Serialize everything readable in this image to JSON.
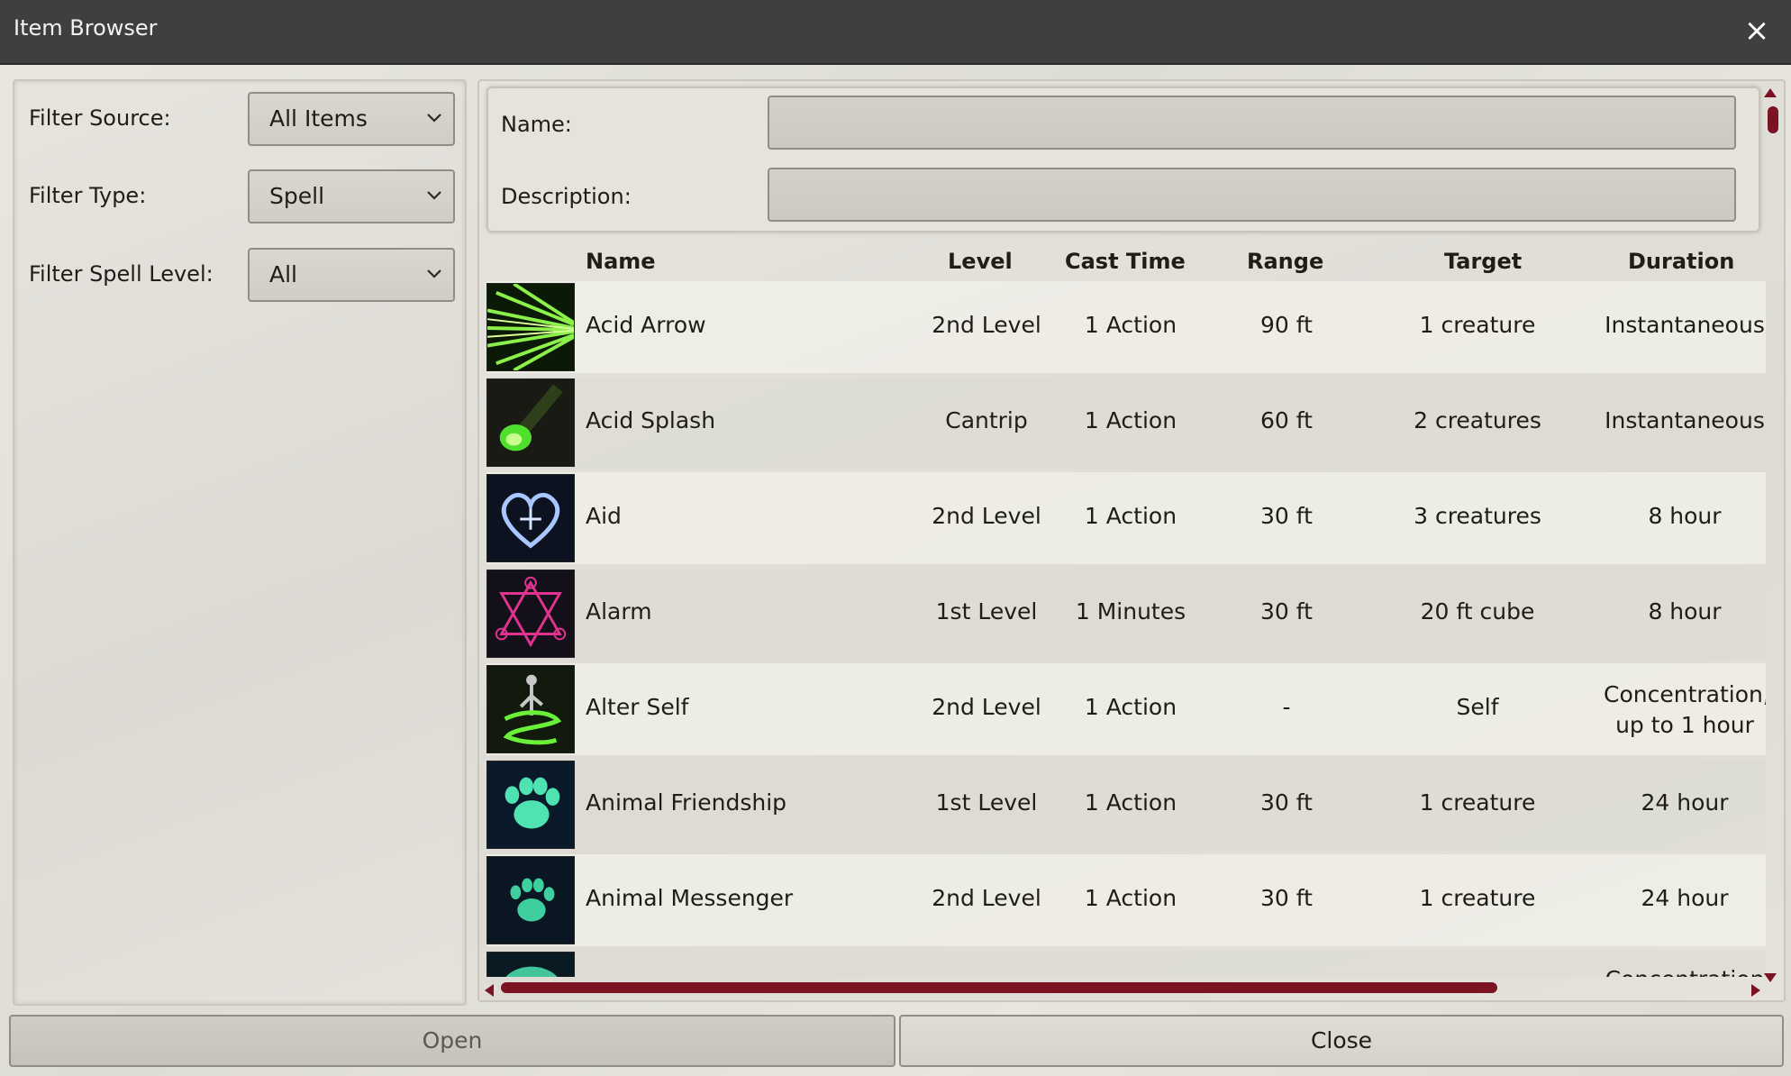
{
  "window": {
    "title": "Item Browser",
    "close_icon": "×"
  },
  "filters": [
    {
      "label": "Filter Source:",
      "value": "All Items"
    },
    {
      "label": "Filter Type:",
      "value": "Spell"
    },
    {
      "label": "Filter Spell Level:",
      "value": "All"
    }
  ],
  "search": {
    "name_label": "Name:",
    "name_value": "",
    "description_label": "Description:",
    "description_value": ""
  },
  "table": {
    "columns": [
      "Name",
      "Level",
      "Cast Time",
      "Range",
      "Target",
      "Duration"
    ],
    "rows": [
      {
        "icon": "acid-arrow-icon",
        "name": "Acid Arrow",
        "level": "2nd Level",
        "cast_time": "1 Action",
        "range": "90 ft",
        "target": "1 creature",
        "duration": "Instantaneous"
      },
      {
        "icon": "acid-splash-icon",
        "name": "Acid Splash",
        "level": "Cantrip",
        "cast_time": "1 Action",
        "range": "60 ft",
        "target": "2 creatures",
        "duration": "Instantaneous"
      },
      {
        "icon": "aid-heart-icon",
        "name": "Aid",
        "level": "2nd Level",
        "cast_time": "1 Action",
        "range": "30 ft",
        "target": "3 creatures",
        "duration": "8 hour"
      },
      {
        "icon": "alarm-sigil-icon",
        "name": "Alarm",
        "level": "1st Level",
        "cast_time": "1 Minutes",
        "range": "30 ft",
        "target": "20 ft cube",
        "duration": "8 hour"
      },
      {
        "icon": "alter-self-icon",
        "name": "Alter Self",
        "level": "2nd Level",
        "cast_time": "1 Action",
        "range": "-",
        "target": "Self",
        "duration": "Concentration, up to 1 hour"
      },
      {
        "icon": "animal-friendship-icon",
        "name": "Animal Friendship",
        "level": "1st Level",
        "cast_time": "1 Action",
        "range": "30 ft",
        "target": "1 creature",
        "duration": "24 hour"
      },
      {
        "icon": "animal-messenger-icon",
        "name": "Animal Messenger",
        "level": "2nd Level",
        "cast_time": "1 Action",
        "range": "30 ft",
        "target": "1 creature",
        "duration": "24 hour"
      },
      {
        "icon": "next-spell-icon",
        "name": "",
        "level": "",
        "cast_time": "",
        "range": "",
        "target": "",
        "duration": "Concentration"
      }
    ]
  },
  "buttons": {
    "open": "Open",
    "close": "Close"
  },
  "colors": {
    "accent": "#7a1322",
    "titlebar": "#3f3f3f"
  }
}
